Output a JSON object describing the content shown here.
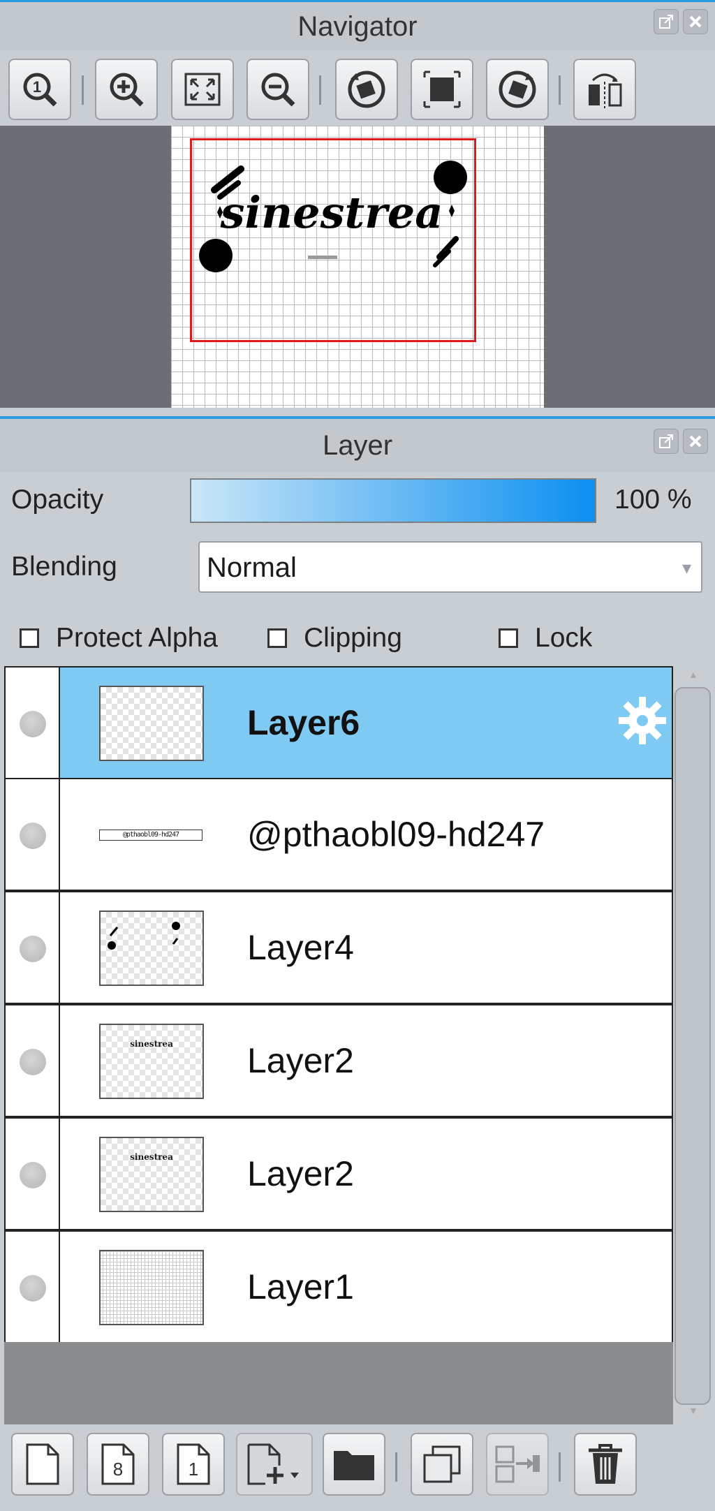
{
  "navigator": {
    "title": "Navigator",
    "canvas_text": "sinestrea",
    "tools": [
      "zoom-actual-size",
      "zoom-in",
      "fit-to-window",
      "zoom-out",
      "rotate-left",
      "reset-view",
      "rotate-right",
      "flip-horizontal"
    ]
  },
  "layer_panel": {
    "title": "Layer",
    "opacity_label": "Opacity",
    "opacity_value": "100 %",
    "blending_label": "Blending",
    "blending_value": "Normal",
    "checkboxes": [
      {
        "label": "Protect Alpha",
        "checked": false
      },
      {
        "label": "Clipping",
        "checked": false
      },
      {
        "label": "Lock",
        "checked": false
      }
    ],
    "layers": [
      {
        "name": "Layer6",
        "selected": true
      },
      {
        "name": "@pthaobl09-hd247",
        "selected": false
      },
      {
        "name": "Layer4",
        "selected": false
      },
      {
        "name": "Layer2",
        "selected": false
      },
      {
        "name": "Layer2",
        "selected": false
      },
      {
        "name": "Layer1",
        "selected": false
      }
    ],
    "thumb_text": {
      "watermark": "@pthaobl09-hd247",
      "title": "sinestrea"
    }
  },
  "bottom_tools": [
    "new-layer",
    "new-8bit-layer",
    "new-1bit-layer",
    "add-layer-menu",
    "new-folder",
    "duplicate-layer",
    "merge-down",
    "delete-layer"
  ],
  "colors": {
    "accent": "#2a9ae0",
    "selected_row": "#7fcaf3",
    "frame": "#e01a1a"
  }
}
